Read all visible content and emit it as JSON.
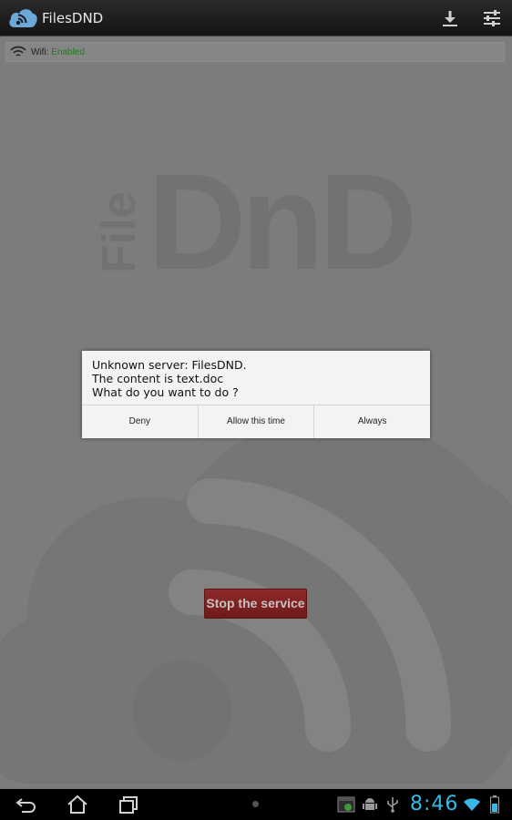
{
  "app": {
    "title": "FilesDND",
    "download_icon": "download-icon",
    "settings_icon": "sliders-icon"
  },
  "wifi": {
    "label": "Wifi:",
    "status": "Enabled",
    "status_color": "#1f7a1f"
  },
  "background": {
    "logo_text_vertical": "File",
    "logo_text_main": "DnD"
  },
  "dialog": {
    "lines": [
      "Unknown server: FilesDND.",
      "The content is text.doc",
      "What do you want to do ?"
    ],
    "buttons": [
      "Deny",
      "Allow this time",
      "Always"
    ]
  },
  "stop_button": {
    "label": "Stop the service",
    "color": "#8e2a2a"
  },
  "navbar": {
    "back_icon": "back-icon",
    "home_icon": "home-icon",
    "recents_icon": "recent-apps-icon"
  },
  "status": {
    "time": "8:46",
    "accent": "#39b7e6"
  }
}
